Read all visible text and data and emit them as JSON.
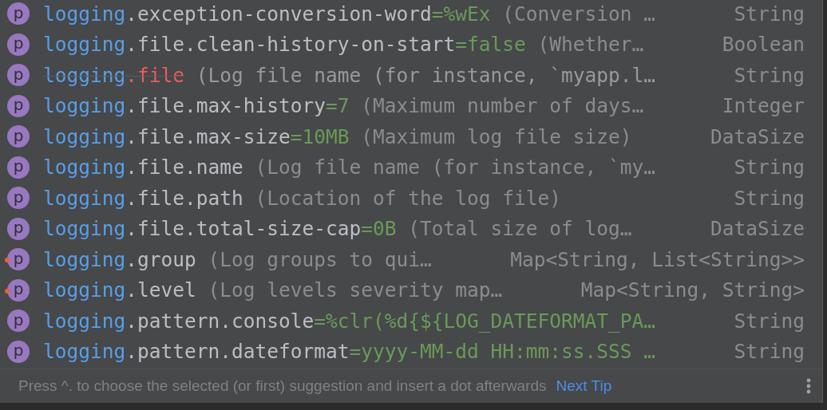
{
  "suggestions": [
    {
      "badge": "p",
      "flagged": false,
      "deprecated": false,
      "name_prefix": "logging",
      "name_rest": ".exception-conversion-word",
      "value": "=%wEx",
      "description": "(Conversion …",
      "type": "String"
    },
    {
      "badge": "p",
      "flagged": false,
      "deprecated": false,
      "name_prefix": "logging",
      "name_rest": ".file.clean-history-on-start",
      "value": "=false",
      "description": "(Whether…",
      "type": "Boolean"
    },
    {
      "badge": "p",
      "flagged": false,
      "deprecated": true,
      "name_prefix": "logging",
      "name_rest": ".file",
      "description": "(Log file name (for instance, `myapp.l…",
      "type": "String"
    },
    {
      "badge": "p",
      "flagged": false,
      "deprecated": false,
      "name_prefix": "logging",
      "name_rest": ".file.max-history",
      "value": "=7",
      "description": "(Maximum number of days…",
      "type": "Integer"
    },
    {
      "badge": "p",
      "flagged": false,
      "deprecated": false,
      "name_prefix": "logging",
      "name_rest": ".file.max-size",
      "value": "=10MB",
      "description": "(Maximum log file size)",
      "type": "DataSize"
    },
    {
      "badge": "p",
      "flagged": false,
      "deprecated": false,
      "name_prefix": "logging",
      "name_rest": ".file.name",
      "description": "(Log file name (for instance, `my…",
      "type": "String"
    },
    {
      "badge": "p",
      "flagged": false,
      "deprecated": false,
      "name_prefix": "logging",
      "name_rest": ".file.path",
      "description": "(Location of the log file)",
      "type": "String"
    },
    {
      "badge": "p",
      "flagged": false,
      "deprecated": false,
      "name_prefix": "logging",
      "name_rest": ".file.total-size-cap",
      "value": "=0B",
      "description": "(Total size of log…",
      "type": "DataSize"
    },
    {
      "badge": "p",
      "flagged": true,
      "deprecated": false,
      "name_prefix": "logging",
      "name_rest": ".group",
      "description": "(Log groups to qui…",
      "type": "Map<String, List<String>>"
    },
    {
      "badge": "p",
      "flagged": true,
      "deprecated": false,
      "name_prefix": "logging",
      "name_rest": ".level",
      "description": "(Log levels severity map…",
      "type": "Map<String, String>"
    },
    {
      "badge": "p",
      "flagged": false,
      "deprecated": false,
      "name_prefix": "logging",
      "name_rest": ".pattern.console",
      "value": "=%clr(%d{${LOG_DATEFORMAT_PA…",
      "type": "String"
    },
    {
      "badge": "p",
      "flagged": false,
      "deprecated": false,
      "name_prefix": "logging",
      "name_rest": ".pattern.dateformat",
      "value": "=yyyy-MM-dd HH:mm:ss.SSS …",
      "type": "String"
    }
  ],
  "footer": {
    "hint": "Press ^. to choose the selected (or first) suggestion and insert a dot afterwards",
    "link": "Next Tip"
  }
}
